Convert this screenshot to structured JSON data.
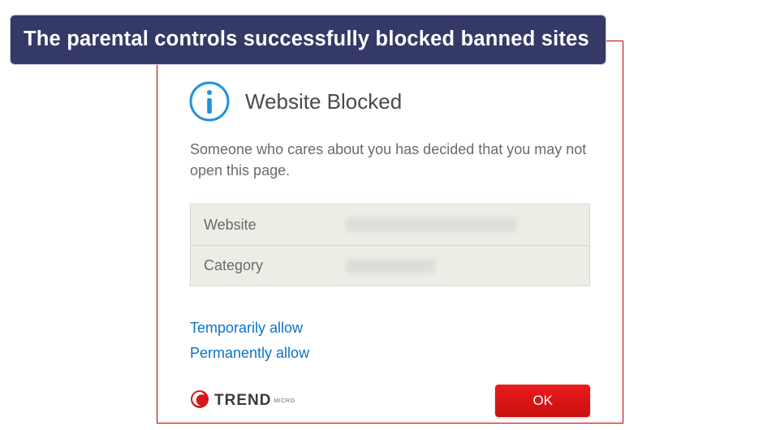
{
  "caption": "The parental controls successfully blocked banned sites",
  "dialog": {
    "title": "Website Blocked",
    "message": "Someone who cares about you has decided that you may not open this page.",
    "rows": {
      "website_label": "Website",
      "category_label": "Category"
    },
    "links": {
      "temporary": "Temporarily allow",
      "permanent": "Permanently allow"
    },
    "brand": "TREND",
    "brand_sub": "MICRO",
    "ok_label": "OK"
  },
  "colors": {
    "accent_red": "#d21a1a",
    "link_blue": "#0a73c9",
    "info_blue": "#1f93d6"
  }
}
